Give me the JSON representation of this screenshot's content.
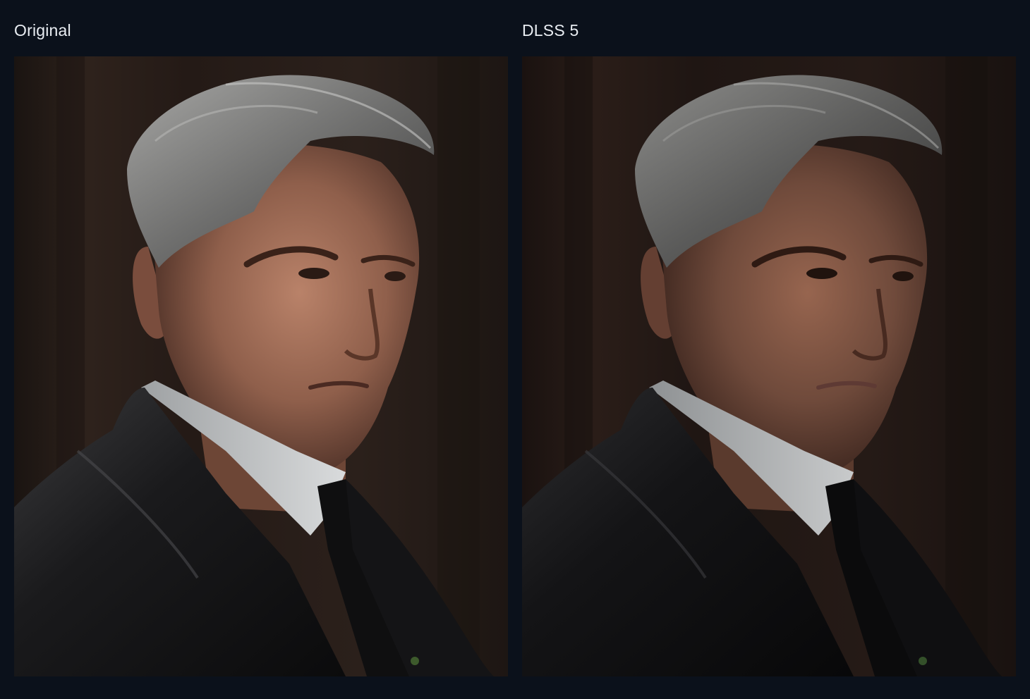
{
  "comparison": {
    "left": {
      "label": "Original",
      "image": "portrait-render-original",
      "palette": {
        "background": "#241b17",
        "skin": "#9a6a53",
        "hair": "#8e8e8c",
        "suit": "#121214",
        "shirt": "#c9cbcc"
      }
    },
    "right": {
      "label": "DLSS 5",
      "image": "portrait-render-dlss5",
      "palette": {
        "background": "#1e1614",
        "skin": "#7a5545",
        "hair": "#6c6c6b",
        "suit": "#0d0d0f",
        "shirt": "#b7b9bb"
      }
    }
  }
}
